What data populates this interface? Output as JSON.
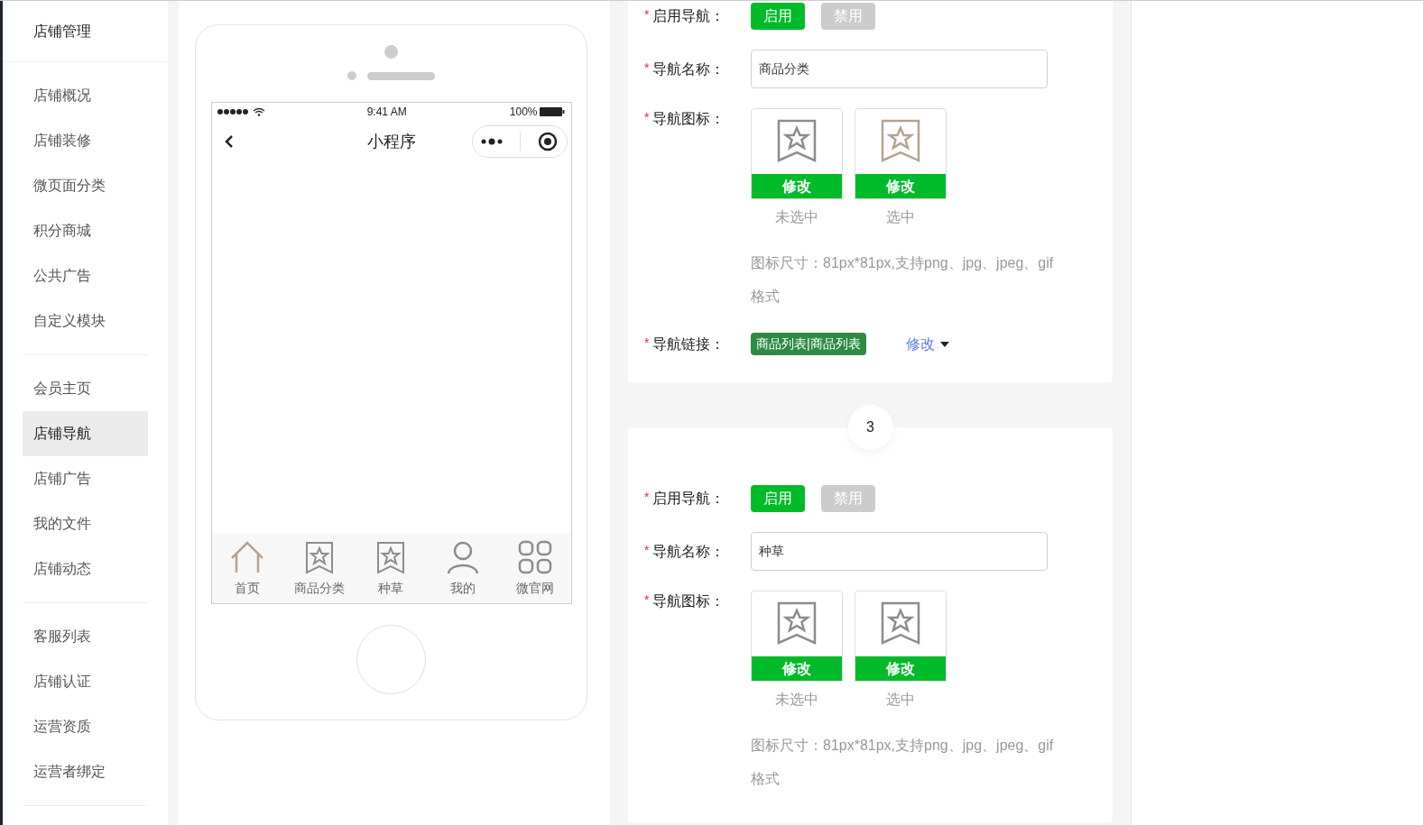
{
  "sidebar": {
    "header": "店铺管理",
    "groups": [
      [
        {
          "label": "店铺概况",
          "selected": false
        },
        {
          "label": "店铺装修",
          "selected": false
        },
        {
          "label": "微页面分类",
          "selected": false
        },
        {
          "label": "积分商城",
          "selected": false
        },
        {
          "label": "公共广告",
          "selected": false
        },
        {
          "label": "自定义模块",
          "selected": false
        }
      ],
      [
        {
          "label": "会员主页",
          "selected": false
        },
        {
          "label": "店铺导航",
          "selected": true
        },
        {
          "label": "店铺广告",
          "selected": false
        },
        {
          "label": "我的文件",
          "selected": false
        },
        {
          "label": "店铺动态",
          "selected": false
        }
      ],
      [
        {
          "label": "客服列表",
          "selected": false
        },
        {
          "label": "店铺认证",
          "selected": false
        },
        {
          "label": "运营资质",
          "selected": false
        },
        {
          "label": "运营者绑定",
          "selected": false
        }
      ]
    ]
  },
  "phone": {
    "time": "9:41 AM",
    "battery": "100%",
    "title": "小程序",
    "tabbar": [
      {
        "label": "首页",
        "kind": "home",
        "selected": true
      },
      {
        "label": "商品分类",
        "kind": "bookmark",
        "selected": false
      },
      {
        "label": "种草",
        "kind": "bookmark",
        "selected": false
      },
      {
        "label": "我的",
        "kind": "user",
        "selected": false
      },
      {
        "label": "微官网",
        "kind": "grid",
        "selected": false
      }
    ]
  },
  "nav_sections": [
    {
      "enable": {
        "required": "*",
        "label": "启用导航：",
        "options": [
          {
            "label": "启用",
            "selected": true
          },
          {
            "label": "禁用",
            "selected": false
          }
        ]
      },
      "name": {
        "required": "*",
        "label": "导航名称：",
        "value": "商品分类"
      },
      "icon": {
        "required": "*",
        "label": "导航图标：",
        "slots": [
          {
            "button": "修改",
            "caption": "未选中",
            "color": "#8c8c8c"
          },
          {
            "button": "修改",
            "caption": "选中",
            "color": "#b4a290"
          }
        ],
        "hint": "图标尺寸：81px*81px,支持png、jpg、jpeg、gif格式"
      },
      "link": {
        "required": "*",
        "label": "导航链接：",
        "tag": "商品列表|商品列表",
        "edit": "修改"
      }
    },
    {
      "number": "3",
      "enable": {
        "required": "*",
        "label": "启用导航：",
        "options": [
          {
            "label": "启用",
            "selected": true
          },
          {
            "label": "禁用",
            "selected": false
          }
        ]
      },
      "name": {
        "required": "*",
        "label": "导航名称：",
        "value": "种草"
      },
      "icon": {
        "required": "*",
        "label": "导航图标：",
        "slots": [
          {
            "button": "修改",
            "caption": "未选中",
            "color": "#8c8c8c"
          },
          {
            "button": "修改",
            "caption": "选中",
            "color": "#8c8c8c"
          }
        ],
        "hint": "图标尺寸：81px*81px,支持png、jpg、jpeg、gif格式"
      }
    }
  ]
}
